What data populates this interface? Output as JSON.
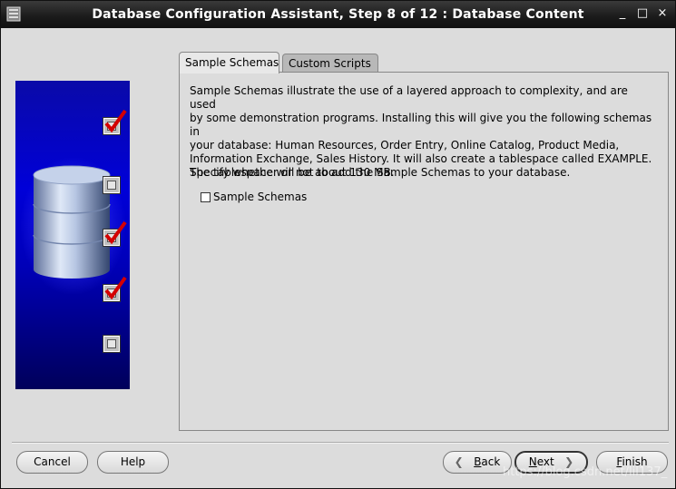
{
  "window": {
    "title": "Database Configuration Assistant, Step 8 of 12 : Database Content",
    "controls": {
      "minimize": "_",
      "maximize": "□",
      "close": "×"
    }
  },
  "tabs": [
    {
      "label": "Sample Schemas",
      "active": true
    },
    {
      "label": "Custom Scripts",
      "active": false
    }
  ],
  "content": {
    "description_lines": [
      "Sample Schemas illustrate the use of a layered approach to complexity, and are used",
      "by some demonstration programs. Installing this will give you the following schemas in",
      "your database: Human Resources, Order Entry, Online Catalog, Product Media,",
      "Information Exchange, Sales History. It will also create a tablespace called EXAMPLE.",
      "The tablespace will be about 130 MB."
    ],
    "specify_text": "Specify whether or not to add the Sample Schemas to your database.",
    "checkbox_label": "Sample Schemas",
    "checkbox_checked": false
  },
  "graphic": {
    "checklist": [
      true,
      false,
      true,
      true,
      false
    ],
    "accent_color": "#cc0000"
  },
  "buttons": {
    "cancel": "Cancel",
    "help": "Help",
    "back_first": "B",
    "back_rest": "ack",
    "next_first": "N",
    "next_rest": "ext",
    "finish_first": "F",
    "finish_rest": "inish"
  },
  "watermark": "https://blog.csdn.net/lil137_"
}
